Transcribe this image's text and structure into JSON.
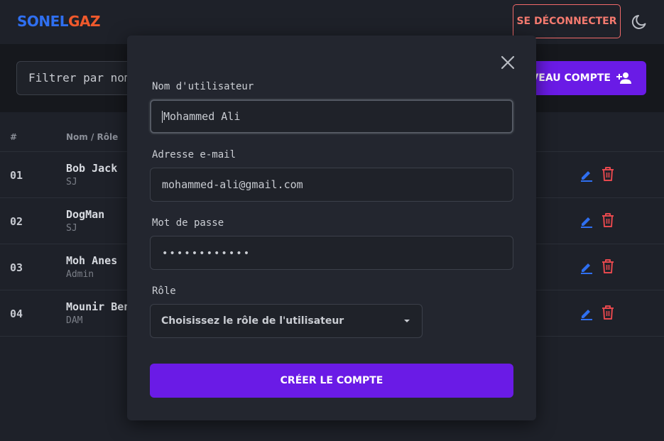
{
  "header": {
    "logo_part1": "SONEL",
    "logo_part2": "GAZ",
    "logout_label": "SE DÉCONNECTER",
    "theme_icon": "moon-icon"
  },
  "toolbar": {
    "filter_placeholder": "Filtrer par nom",
    "new_account_label": "UVEAU COMPTE",
    "new_account_icon": "add-user-icon"
  },
  "table": {
    "columns": [
      "#",
      "Nom / Rôle"
    ],
    "rows": [
      {
        "num": "01",
        "name": "Bob Jack",
        "role": "SJ"
      },
      {
        "num": "02",
        "name": "DogMan",
        "role": "SJ"
      },
      {
        "num": "03",
        "name": "Moh Anes",
        "role": "Admin"
      },
      {
        "num": "04",
        "name": "Mounir Benz",
        "role": "DAM"
      }
    ]
  },
  "modal": {
    "username_label": "Nom d'utilisateur",
    "username_value": "Mohammed Ali",
    "email_label": "Adresse e-mail",
    "email_value": "mohammed-ali@gmail.com",
    "password_label": "Mot de passe",
    "password_value": "••••••••••••",
    "role_label": "Rôle",
    "role_select_value": "Choisissez le rôle de l'utilisateur",
    "submit_label": "CRÉER LE COMPTE",
    "close_icon": "close-icon"
  },
  "colors": {
    "accent": "#6a1be6",
    "logo_blue": "#2f6ff0",
    "logo_orange": "#f0592c",
    "danger": "#e5484d",
    "edit": "#2f6ff0"
  }
}
